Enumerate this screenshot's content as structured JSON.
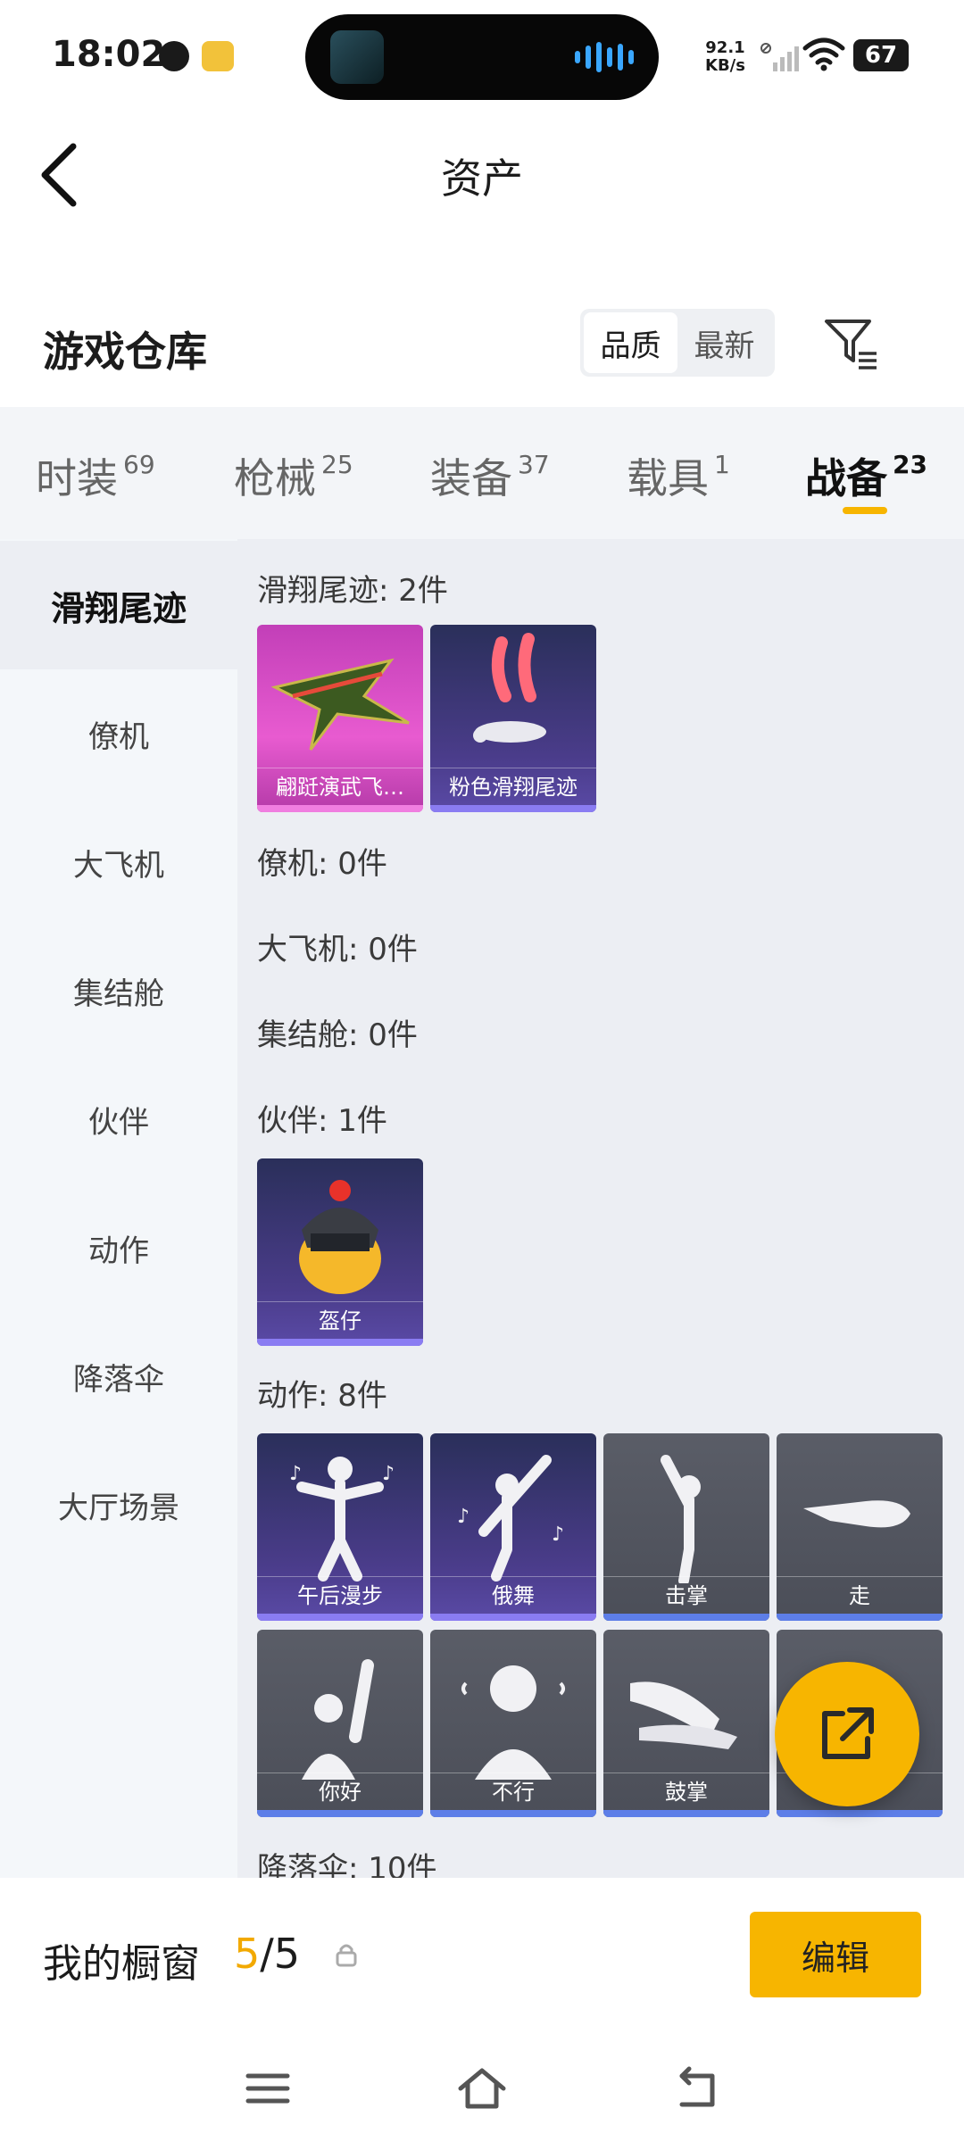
{
  "status_bar": {
    "time": "18:02",
    "net_speed_value": "92.1",
    "net_speed_unit": "KB/s",
    "battery": "67"
  },
  "header": {
    "title": "资产"
  },
  "warehouse": {
    "title": "游戏仓库",
    "sort_options": [
      "品质",
      "最新"
    ],
    "active_sort": "品质"
  },
  "tabs": [
    {
      "label": "时装",
      "count": "69"
    },
    {
      "label": "枪械",
      "count": "25"
    },
    {
      "label": "装备",
      "count": "37"
    },
    {
      "label": "载具",
      "count": "1"
    },
    {
      "label": "战备",
      "count": "23"
    }
  ],
  "active_tab": "战备",
  "sidebar": {
    "items": [
      "滑翔尾迹",
      "僚机",
      "大飞机",
      "集结舱",
      "伙伴",
      "动作",
      "降落伞",
      "大厅场景"
    ],
    "active": "滑翔尾迹"
  },
  "sections": {
    "glide": {
      "title": "滑翔尾迹: 2件",
      "items": [
        "翩跹演武飞…",
        "粉色滑翔尾迹"
      ]
    },
    "wingman": {
      "title": "僚机: 0件"
    },
    "big_plane": {
      "title": "大飞机: 0件"
    },
    "pod": {
      "title": "集结舱: 0件"
    },
    "partner": {
      "title": "伙伴: 1件",
      "items": [
        "盔仔"
      ]
    },
    "emote": {
      "title": "动作: 8件",
      "items": [
        "午后漫步",
        "俄舞",
        "击掌",
        "走",
        "你好",
        "不行",
        "鼓掌",
        ""
      ]
    },
    "parachute": {
      "title": "降落伞: 10件"
    }
  },
  "showcase": {
    "title": "我的橱窗",
    "current": "5",
    "separator": "/",
    "max": "5",
    "edit_label": "编辑"
  },
  "colors": {
    "accent": "#f7b500",
    "count_accent": "#f2a900",
    "rarity_pink": "#e85bd0",
    "rarity_purple": "#5a4aa6",
    "rarity_blue": "#5d7ee8"
  }
}
